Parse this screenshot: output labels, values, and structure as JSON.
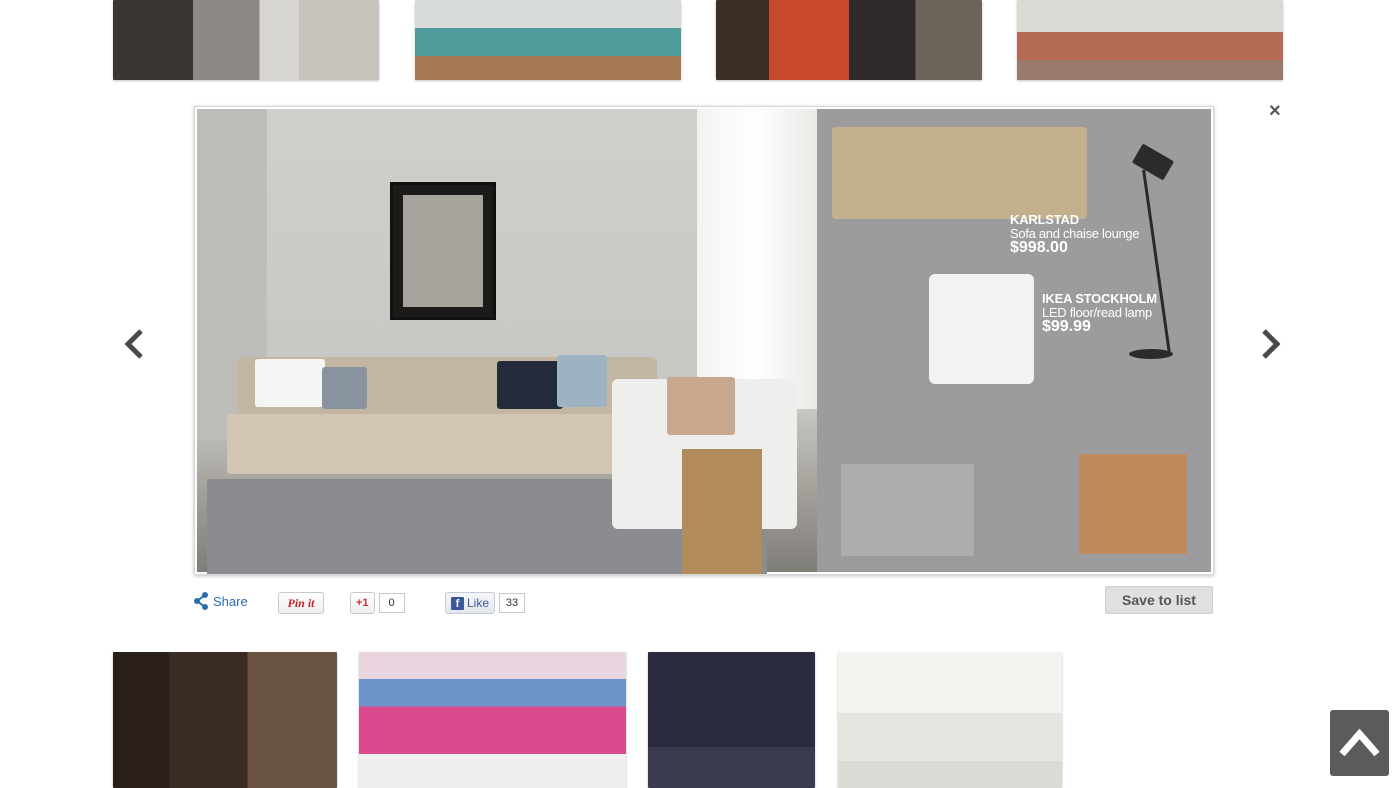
{
  "lightbox": {
    "close_glyph": "×",
    "products": [
      {
        "name": "KARLSTAD",
        "description": "Sofa and chaise lounge",
        "price": "$998.00"
      },
      {
        "name": "IKEA STOCKHOLM",
        "description": "LED floor/read lamp",
        "price": "$99.99"
      }
    ]
  },
  "social": {
    "share_label": "Share",
    "pinit_label": "Pin it",
    "gplus_label": "+1",
    "gplus_count": "0",
    "fb_like_label": "Like",
    "fb_like_count": "33"
  },
  "actions": {
    "save_label": "Save to list"
  },
  "colors": {
    "share_blue": "#2a6eb1",
    "pinterest_red": "#c8232c",
    "facebook_blue": "#3b5998",
    "scroll_top_bg": "#5b5b5b"
  },
  "icons": [
    "close-icon",
    "chevron-left-icon",
    "chevron-right-icon",
    "share-icon",
    "facebook-icon",
    "arrow-up-icon"
  ]
}
